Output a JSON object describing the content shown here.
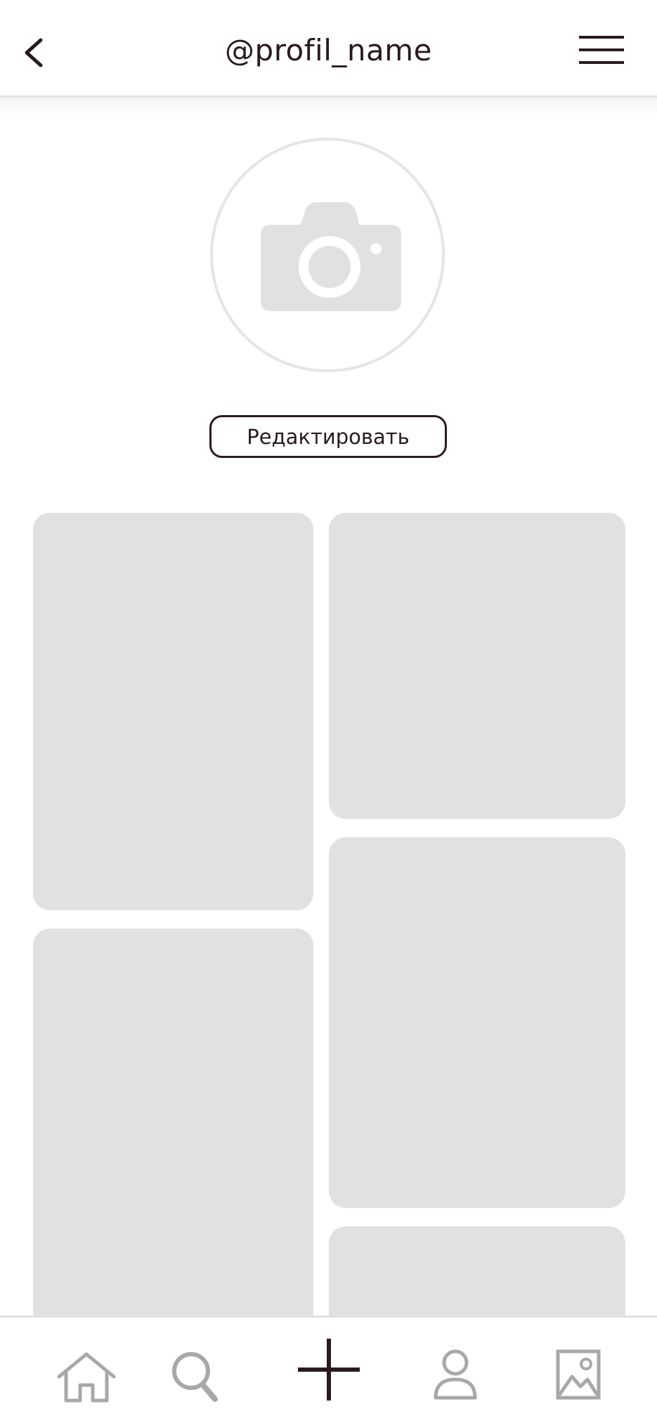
{
  "header": {
    "title": "@profil_name",
    "back_icon": "chevron-left-icon",
    "menu_icon": "hamburger-menu-icon"
  },
  "avatar": {
    "icon": "camera-icon"
  },
  "edit_button": {
    "label": "Редактировать"
  },
  "gallery": {
    "tiles": [
      "post-1",
      "post-2",
      "post-3",
      "post-4",
      "post-5"
    ]
  },
  "bottom_nav": {
    "items": [
      "home-icon",
      "search-icon",
      "add-icon",
      "profile-icon",
      "gallery-icon"
    ]
  },
  "colors": {
    "primary_text": "#2a1a20",
    "placeholder": "#e2e1e2",
    "inactive_icon": "#a9a7a8",
    "divider": "#e6e4e5"
  }
}
